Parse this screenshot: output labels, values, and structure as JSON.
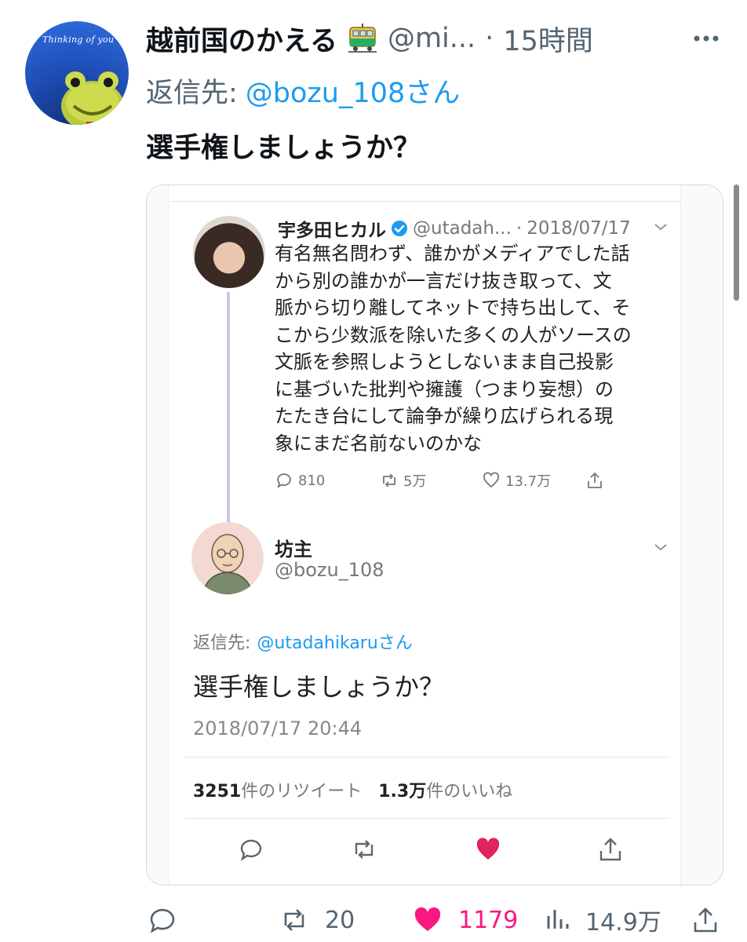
{
  "tweet": {
    "avatar_caption": "Thinking of you",
    "display_name": "越前国のかえる",
    "handle": "@mi...",
    "separator": "·",
    "time": "15時間",
    "reply_label": "返信先:",
    "reply_user": "@bozu_108さん",
    "text": "選手権しましょうか？"
  },
  "embed": {
    "original": {
      "name": "宇多田ヒカル",
      "handle": "@utadah...",
      "separator": "·",
      "date": "2018/07/17",
      "lines": [
        "有名無名問わず、誰かがメディアでした話",
        "から別の誰かが一言だけ抜き取って、文",
        "脈から切り離してネットで持ち出して、そ",
        "こから少数派を除いた多くの人がソースの",
        "文脈を参照しようとしないまま自己投影",
        "に基づいた批判や擁護（つまり妄想）の",
        "たたき台にして論争が繰り広げられる現",
        "象にまだ名前ないのかな"
      ],
      "replies": "810",
      "retweets": "5万",
      "likes": "13.7万"
    },
    "reply": {
      "name": "坊主",
      "handle": "@bozu_108",
      "reply_label": "返信先:",
      "reply_user": "@utadahikaruさん",
      "text": "選手権しましょうか？",
      "datetime": "2018/07/17 20:44",
      "retweet_count": "3251",
      "retweet_label": "件のリツイート",
      "like_count": "1.3万",
      "like_label": "件のいいね"
    }
  },
  "actions": {
    "replies": "",
    "retweets": "20",
    "likes": "1179",
    "views": "14.9万"
  },
  "colors": {
    "accent": "#1d9bf0",
    "like": "#f91880",
    "secondary": "#536471"
  }
}
